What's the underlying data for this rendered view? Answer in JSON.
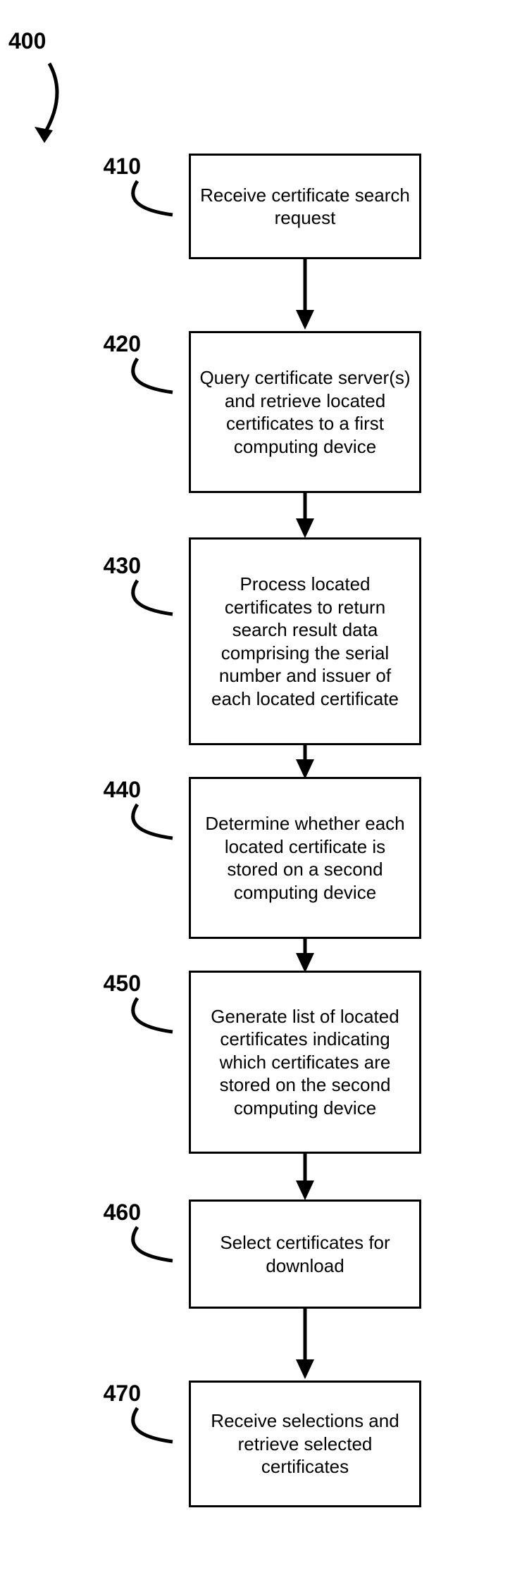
{
  "flowchart": {
    "main_label": "400",
    "steps": [
      {
        "num": "410",
        "text": "Receive certificate search request"
      },
      {
        "num": "420",
        "text": "Query certificate server(s) and retrieve located certificates to a first computing device"
      },
      {
        "num": "430",
        "text": "Process located certificates to return search result data comprising the serial number and issuer of each located certificate"
      },
      {
        "num": "440",
        "text": "Determine whether each located certificate is stored on a second computing device"
      },
      {
        "num": "450",
        "text": "Generate list of located certificates indicating which certificates are stored on the second computing device"
      },
      {
        "num": "460",
        "text": "Select certificates for download"
      },
      {
        "num": "470",
        "text": "Receive selections and retrieve selected certificates"
      }
    ]
  }
}
